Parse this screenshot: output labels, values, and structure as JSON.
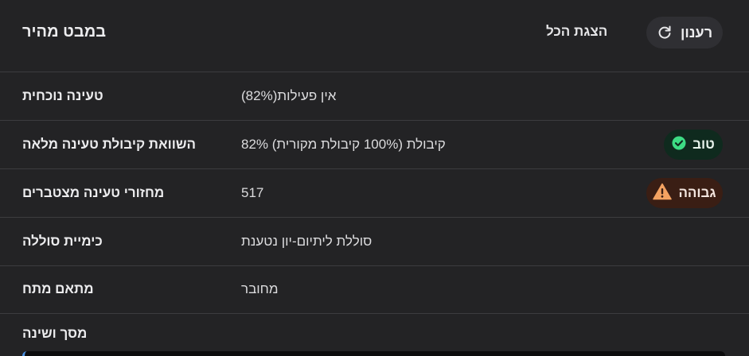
{
  "header": {
    "title": "במבט מהיר",
    "show_all_label": "הצגת הכל",
    "refresh_label": "רענון",
    "refresh_icon": "refresh-icon"
  },
  "rows": [
    {
      "label": "טעינה נוכחית",
      "value": "אין פעילות(82%)"
    },
    {
      "label": "השוואת קיבולת טעינה מלאה",
      "value": "קיבולת (100% קיבולת מקורית) 82%",
      "badge": {
        "label": "טוב",
        "icon": "check-circle-icon",
        "color": "#3ddc84"
      }
    },
    {
      "label": "מחזורי טעינה מצטברים",
      "value": "517",
      "badge": {
        "label": "גבוהה",
        "icon": "warning-triangle-icon",
        "color": "#f4a261"
      }
    },
    {
      "label": "כימיית סוללה",
      "value": "סוללת ליתיום-יון נטענת"
    },
    {
      "label": "מתאם מתח",
      "value": "מחובר"
    }
  ],
  "section": {
    "label": "מסך ושינה"
  }
}
